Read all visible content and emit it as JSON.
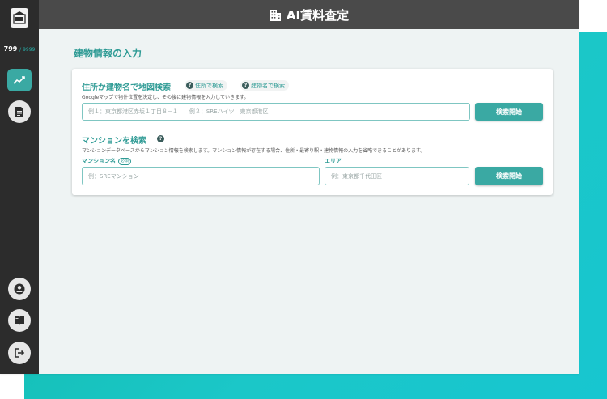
{
  "app": {
    "title": "AI賃料査定",
    "logo_text": "賃料査定"
  },
  "sidebar": {
    "count_used": "799",
    "count_max": "/ 9999",
    "items": [
      {
        "icon": "trend-chart-icon",
        "active": true
      },
      {
        "icon": "document-icon",
        "active": false
      }
    ],
    "bottom_items": [
      {
        "icon": "user-icon"
      },
      {
        "icon": "book-icon"
      },
      {
        "icon": "logout-icon"
      }
    ]
  },
  "page": {
    "title": "建物情報の入力"
  },
  "map_search": {
    "title": "住所か建物名で地図検索",
    "help_address": "住所で検索",
    "help_building": "建物名で検索",
    "description": "Googleマップで物件位置を決定し、その後に建物情報を入力していきます。",
    "placeholder": "例１：東京都港区赤坂１丁目８−１　　例２：SREハイツ　東京都港区",
    "button": "検索開始"
  },
  "mansion_search": {
    "title": "マンションを検索",
    "description": "マンションデータベースからマンション情報を検索します。マンション情報が存在する場合、住所・最寄り駅・建物情報の入力を省略できることがあります。",
    "name_label": "マンション名",
    "required": "必須",
    "name_placeholder": "例：SREマンション",
    "area_label": "エリア",
    "area_placeholder": "例：東京都千代田区",
    "button": "検索開始"
  },
  "colors": {
    "accent": "#3aa9a3",
    "sidebar": "#2c2c2c",
    "topbar": "#4a4a4a",
    "background_gradient": "#17c6c0"
  }
}
